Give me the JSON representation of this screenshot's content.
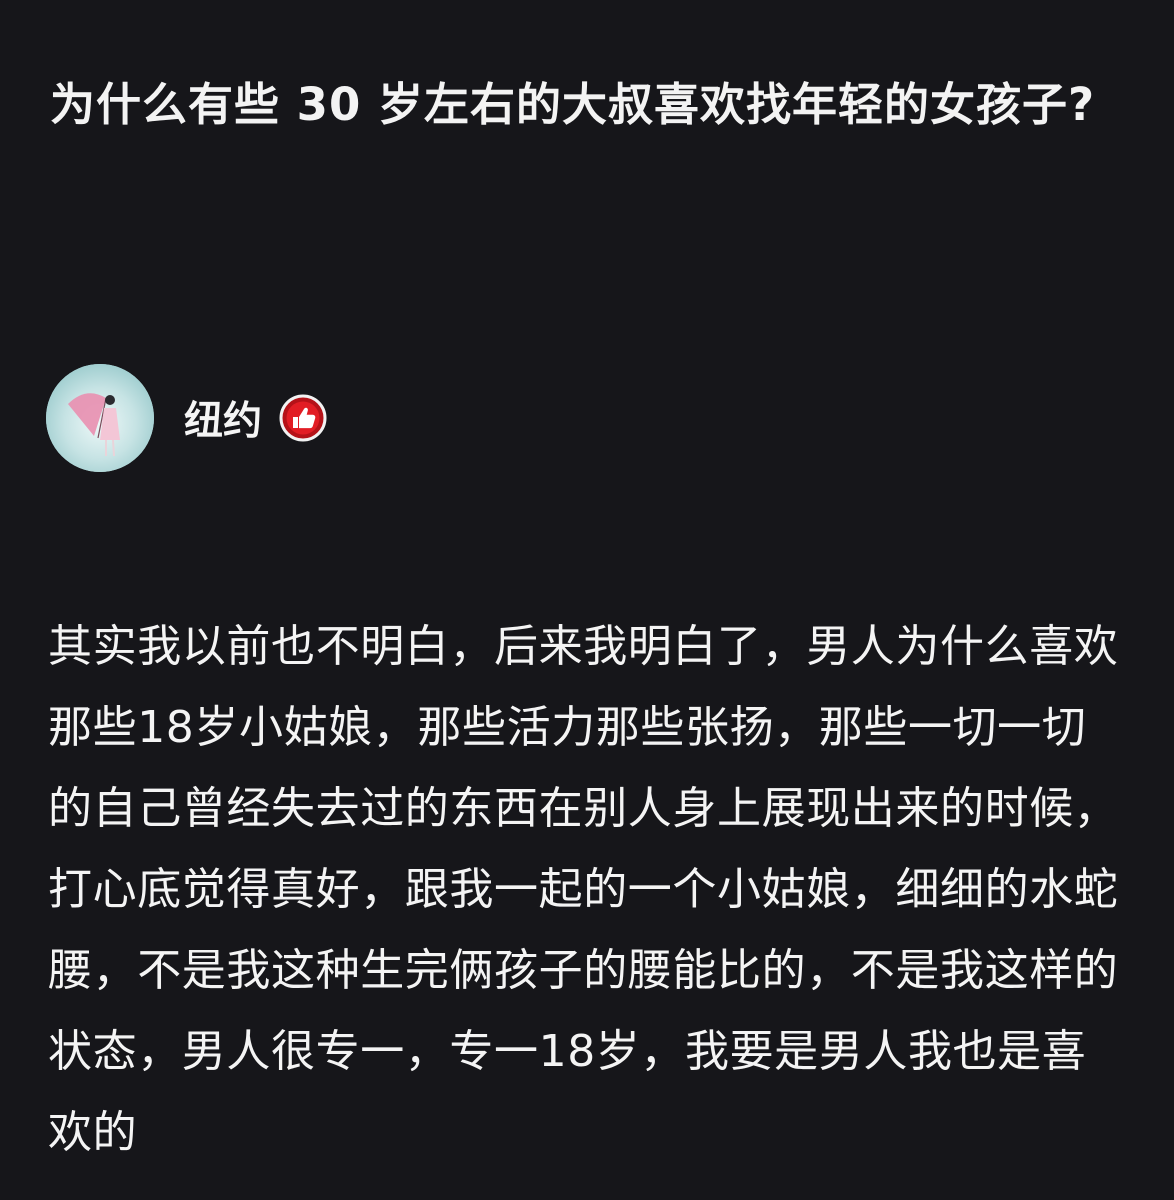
{
  "question": {
    "title": "为什么有些 30 岁左右的大叔喜欢找年轻的女孩子?"
  },
  "author": {
    "name": "纽约",
    "avatar_icon": "avatar-girl-pink-umbrella",
    "badge_icon": "thumbs-up-badge-icon",
    "badge_color": "#d9161c"
  },
  "answer": {
    "text": "其实我以前也不明白，后来我明白了，男人为什么喜欢那些18岁小姑娘，那些活力那些张扬，那些一切一切的自己曾经失去过的东西在别人身上展现出来的时候，打心底觉得真好，跟我一起的一个小姑娘，细细的水蛇腰，不是我这种生完俩孩子的腰能比的，不是我这样的状态，男人很专一，专一18岁，我要是男人我也是喜欢的"
  }
}
